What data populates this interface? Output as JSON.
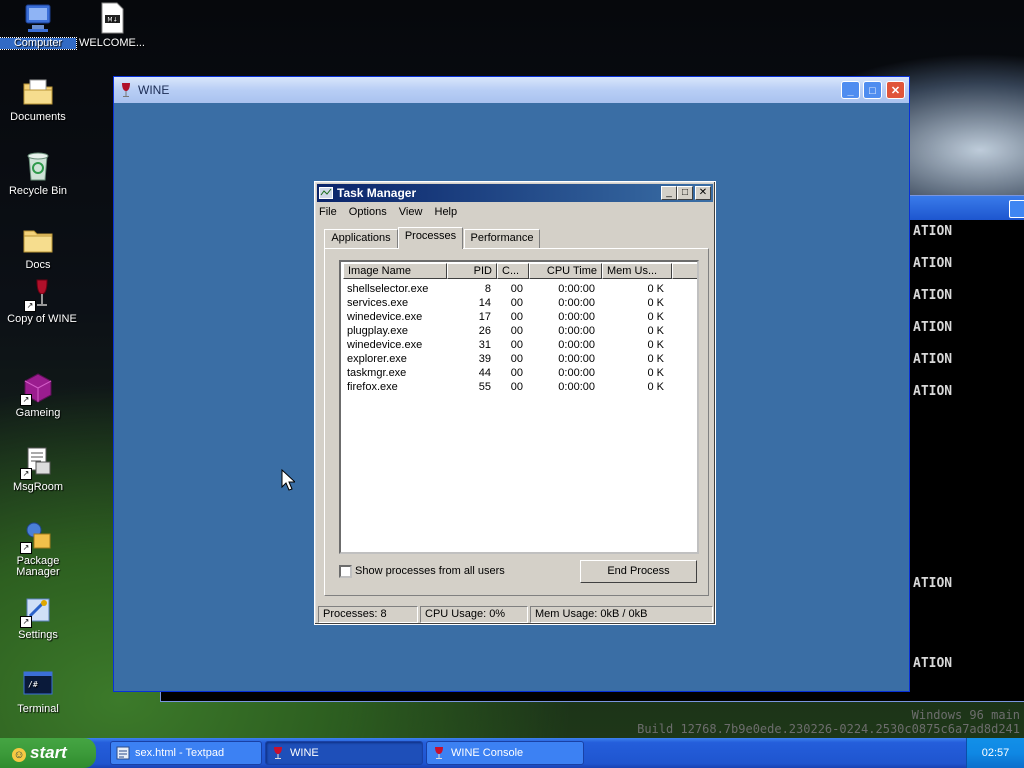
{
  "desktop": {
    "icons": [
      {
        "label": "Computer"
      },
      {
        "label": "WELCOME..."
      },
      {
        "label": "Documents"
      },
      {
        "label": "Recycle Bin"
      },
      {
        "label": "Docs"
      },
      {
        "label": "Copy of WINE"
      },
      {
        "label": "Gameing"
      },
      {
        "label": "MsgRoom"
      },
      {
        "label": "Package Manager"
      },
      {
        "label": "Settings"
      },
      {
        "label": "Terminal"
      }
    ]
  },
  "console": {
    "lines": [
      "ATION",
      "ATION",
      "ATION",
      "ATION",
      "ATION",
      "ATION",
      "ATION",
      "ATION"
    ]
  },
  "build": {
    "line1": "Windows 96 main",
    "line2": "Build 12768.7b9e0ede.230226-0224.2530c0875c6a7ad8d241"
  },
  "wine_window": {
    "title": "WINE",
    "min": "_",
    "max": "□",
    "close": "✕"
  },
  "task_manager": {
    "title": "Task Manager",
    "menu": [
      "File",
      "Options",
      "View",
      "Help"
    ],
    "tabs": [
      "Applications",
      "Processes",
      "Performance"
    ],
    "active_tab": "Processes",
    "columns": [
      "Image Name",
      "PID",
      "C...",
      "CPU Time",
      "Mem Us..."
    ],
    "rows": [
      {
        "name": "shellselector.exe",
        "pid": "8",
        "cpu": "00",
        "time": "0:00:00",
        "mem": "0 K"
      },
      {
        "name": "services.exe",
        "pid": "14",
        "cpu": "00",
        "time": "0:00:00",
        "mem": "0 K"
      },
      {
        "name": "winedevice.exe",
        "pid": "17",
        "cpu": "00",
        "time": "0:00:00",
        "mem": "0 K"
      },
      {
        "name": "plugplay.exe",
        "pid": "26",
        "cpu": "00",
        "time": "0:00:00",
        "mem": "0 K"
      },
      {
        "name": "winedevice.exe",
        "pid": "31",
        "cpu": "00",
        "time": "0:00:00",
        "mem": "0 K"
      },
      {
        "name": "explorer.exe",
        "pid": "39",
        "cpu": "00",
        "time": "0:00:00",
        "mem": "0 K"
      },
      {
        "name": "taskmgr.exe",
        "pid": "44",
        "cpu": "00",
        "time": "0:00:00",
        "mem": "0 K"
      },
      {
        "name": "firefox.exe",
        "pid": "55",
        "cpu": "00",
        "time": "0:00:00",
        "mem": "0 K"
      }
    ],
    "show_all_label": "Show processes from all users",
    "end_process_label": "End Process",
    "status": {
      "processes": "Processes: 8",
      "cpu": "CPU Usage:   0%",
      "mem": "Mem Usage: 0kB / 0kB"
    }
  },
  "taskbar": {
    "start_label": "start",
    "buttons": [
      {
        "label": "sex.html - Textpad"
      },
      {
        "label": "WINE"
      },
      {
        "label": "WINE Console"
      }
    ],
    "clock": "02:57"
  }
}
